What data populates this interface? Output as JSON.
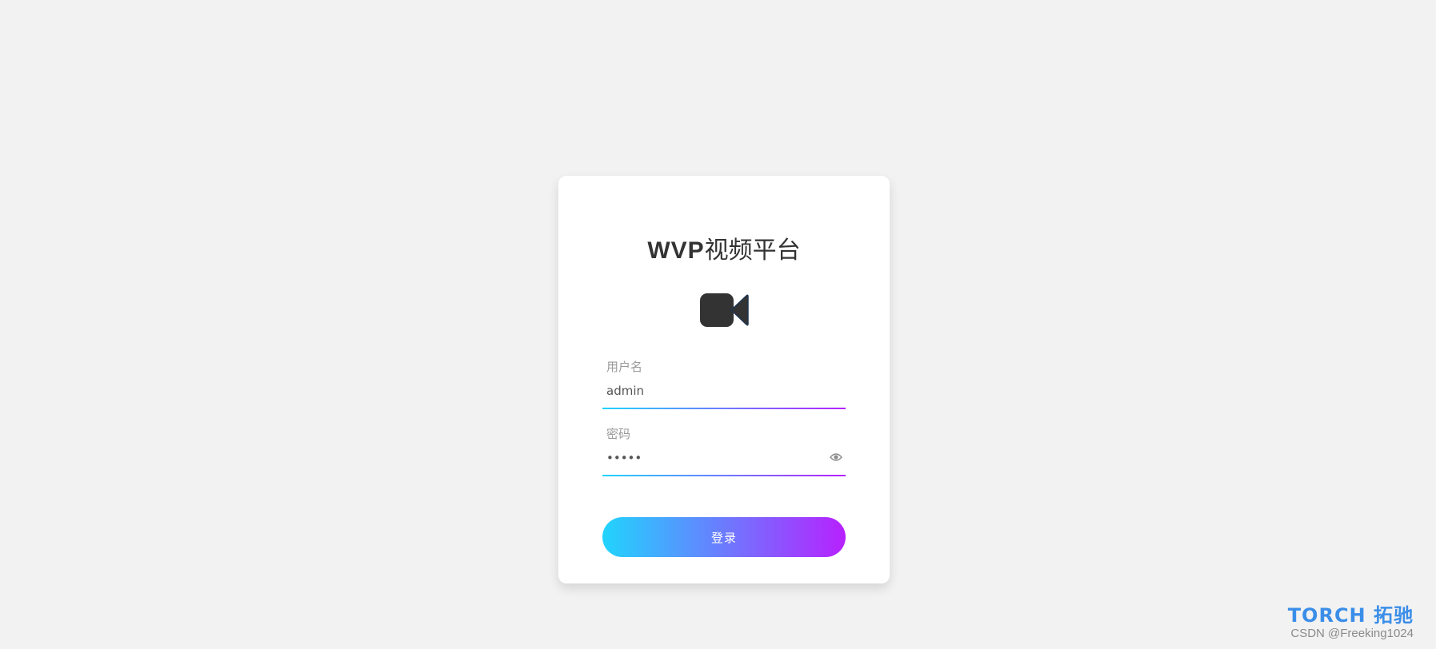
{
  "login": {
    "title_bold": "WVP",
    "title_rest": "视频平台",
    "icon": "video-camera-icon",
    "username": {
      "label": "用户名",
      "value": "admin"
    },
    "password": {
      "label": "密码",
      "value": "•••••",
      "toggle_icon": "eye-icon"
    },
    "submit_label": "登录"
  },
  "colors": {
    "background": "#f2f2f2",
    "card": "#ffffff",
    "gradient_start": "#21d4fd",
    "gradient_end": "#b721ff",
    "logo": "#3b8ee8"
  },
  "watermark": {
    "logo_text": "TORCH 拓驰",
    "credit": "CSDN @Freeking1024"
  }
}
